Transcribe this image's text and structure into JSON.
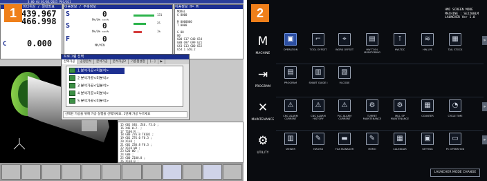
{
  "badges": {
    "left": "1",
    "right": "2"
  },
  "panel1": {
    "topbar": "3:00 AU 01/03/2025 P01/011",
    "pos": {
      "header": "미다위상 / 절대좌표",
      "x": "439.967",
      "z": "466.998",
      "c_label": "C",
      "c": "0.000"
    },
    "mid": {
      "header": "이송정보 / 주축정보",
      "s1": "S",
      "s1_val": "0",
      "s1_sub": "M%/0%  ≈≈≈%",
      "s2": "S",
      "s2_val": "0",
      "s2_sub": "M%/0%  ≈≈≈%",
      "f": "F",
      "f_val": "0",
      "f_sub": "MM/MIN",
      "nums": [
        "131",
        "25",
        "1%"
      ]
    },
    "right": {
      "header": "이송정보  H=  M",
      "lines": [
        "MODAL",
        "G 0000",
        "",
        "M 0000000",
        "T 0000",
        "",
        "G  00",
        "    00",
        "G00  G17  G40  G54",
        "G80  G97  G99  G21",
        "G43  G13  G00  G52",
        "     G54.1  G50.2"
      ]
    },
    "dialog": {
      "title": "프로그램 선택",
      "tabs": [
        "선택가공",
        "공정분석",
        "분석가공",
        "분석가공2",
        "기준점설정",
        "[...]",
        "▶"
      ],
      "items": [
        "1 분석가공<미분석>",
        "2 분석가공<미분석>",
        "3 분석가공<임분석>",
        "4 분석가공<미분석>",
        "5 분석가공<미분석>"
      ],
      "message": "선택된 가공을 위해 가공 실행을 선택하세요. 1번째 가공 누르세요"
    },
    "program": [
      "15 G01 X46. Z46. F3.0 ;",
      "16 X46 W-2. ;",
      "17 T100 M ;",
      "18 G00 Z76.0 T0101 ;",
      "19 G01 Z76.0 F0.3 ;",
      "20 X130 ;",
      "21 G01 Z30.8 F0.3 ;",
      "22 X120 W0 ;",
      "23 U20 W0 ;",
      "24 G00 ;",
      "25 G00 Z100.0 ;",
      "26 X130.0 ;"
    ]
  },
  "panel2": {
    "header": [
      "HMI SCREEN MODE",
      "MACHINE : SE2200LM",
      "LAUNCHER Ver 1.0"
    ],
    "categories": [
      {
        "glyph": "M",
        "label": "MACHINE"
      },
      {
        "glyph": "⇥",
        "label": "PROGRAM"
      },
      {
        "glyph": "✕",
        "label": "MAINTENANCE"
      },
      {
        "glyph": "⚙",
        "label": "UTILITY"
      }
    ],
    "rows": [
      [
        {
          "glyph": "▣",
          "label": "OPERATION",
          "active": true
        },
        {
          "glyph": "⌐",
          "label": "TOOL OFFSET"
        },
        {
          "glyph": "⌖",
          "label": "WORK OFFSET"
        },
        {
          "glyph": "▤",
          "label": "HW TOOL MONITORING"
        },
        {
          "glyph": "⊺",
          "label": "HW-TDC"
        },
        {
          "glyph": "≋",
          "label": "HW-LPS"
        },
        {
          "glyph": "▦",
          "label": "TAIL STOCK"
        }
      ],
      [
        {
          "glyph": "▤",
          "label": "PROGRAM"
        },
        {
          "glyph": "▥",
          "label": "SMART GUIDE i"
        },
        {
          "glyph": "▧",
          "label": "M-CODE"
        }
      ],
      [
        {
          "glyph": "⚠",
          "label": "CNC ALARM CURRENT"
        },
        {
          "glyph": "⚠",
          "label": "CNC ALARM HISTORY"
        },
        {
          "glyph": "⚠",
          "label": "PLC ALARM CURRENT"
        },
        {
          "glyph": "⚙",
          "label": "TURRET MAINTENANCE"
        },
        {
          "glyph": "⚙",
          "label": "MILL SP MAINTENANCE"
        },
        {
          "glyph": "▦",
          "label": "COUNTER"
        },
        {
          "glyph": "◔",
          "label": "CYCLE TIME"
        }
      ],
      [
        {
          "glyph": "▥",
          "label": "VIEWER"
        },
        {
          "glyph": "✎",
          "label": "HW-ESS"
        },
        {
          "glyph": "▬",
          "label": "F&S MANAGER"
        },
        {
          "glyph": "✎",
          "label": "MEMO"
        },
        {
          "glyph": "▦",
          "label": "CALENDAR"
        },
        {
          "glyph": "▣",
          "label": "SETTING"
        },
        {
          "glyph": "▭",
          "label": "PC OPERATION"
        }
      ]
    ],
    "more": "»",
    "launcher_btn": "LAUNCHER MODE CHANGE"
  },
  "colors": {
    "badge": "#ef7f1a",
    "fanuc_blue": "#1d2f91",
    "dark_bg": "#0a0c10",
    "active_tile": "#2c4fa3"
  }
}
